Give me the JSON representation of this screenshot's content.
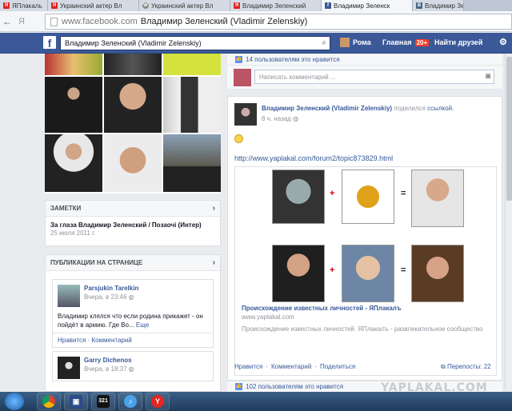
{
  "browser": {
    "tabs": [
      {
        "label": "ЯПлакаль",
        "icon": "yaplakal-icon",
        "active": false
      },
      {
        "label": "Украинский актер Вл",
        "icon": "yaplakal-icon",
        "active": false
      },
      {
        "label": "Украинский актер Вл",
        "icon": "wordpress-icon",
        "active": false
      },
      {
        "label": "Владимир Зеленский",
        "icon": "yaplakal-icon",
        "active": false
      },
      {
        "label": "Владимир Зеленск",
        "icon": "facebook-icon",
        "active": true
      },
      {
        "label": "Владимир Зе",
        "icon": "vk-icon",
        "active": false
      }
    ],
    "url_host": "www.facebook.com",
    "url_title": "Владимир Зеленский (Vladimir Zelenskiy)"
  },
  "fb": {
    "search_value": "Владимир Зеленский (Vladimir Zelenskiy)",
    "user": "Рома",
    "home_label": "Главная",
    "home_badge": "20+",
    "friends_label": "Найти друзей"
  },
  "notes": {
    "header": "ЗАМЕТКИ",
    "title": "За глаза Владимир Зеленский / Позаочі (Интер)",
    "date": "25 июля 2011 г."
  },
  "publications": {
    "header": "ПУБЛИКАЦИИ НА СТРАНИЦЕ",
    "posts": [
      {
        "author": "Parsjukin Tarelkin",
        "time": "Вчера, в 23:46",
        "text": "Владимир клялся что если родина прикажет - он пойдёт в армию. Где Во...",
        "more": "Еще",
        "like": "Нравится",
        "comment": "Комментарий"
      },
      {
        "author": "Garry Dichenos",
        "time": "Вчера, в 18:37"
      }
    ]
  },
  "top": {
    "likes_text": "14 пользователям это нравится",
    "comment_placeholder": "Написать комментарий ..."
  },
  "share_post": {
    "author": "Владимир Зеленский (Vladimir Zelenskiy)",
    "action": "поделился",
    "link_word": "ссылкой.",
    "time": "8 ч. назад",
    "url": "http://www.yaplakal.com/forum2/topic873829.html",
    "preview_title": "Происхождение известных личностей - ЯПлакалъ",
    "preview_domain": "www.yaplakal.com",
    "preview_desc": "Происхождение известных личностей. ЯПлакалъ - развлекательное сообщество",
    "like": "Нравится",
    "comment": "Комментарий",
    "share": "Поделиться",
    "reposts": "Перепосты: 22",
    "likes_text": "102 пользователям это нравится"
  },
  "watermark": "YAPLAKAL.COM",
  "taskbar": {
    "items": [
      "windows-start-icon",
      "chrome-icon",
      "save-icon",
      "media-player-classic-icon",
      "itunes-icon",
      "yandex-icon"
    ]
  }
}
